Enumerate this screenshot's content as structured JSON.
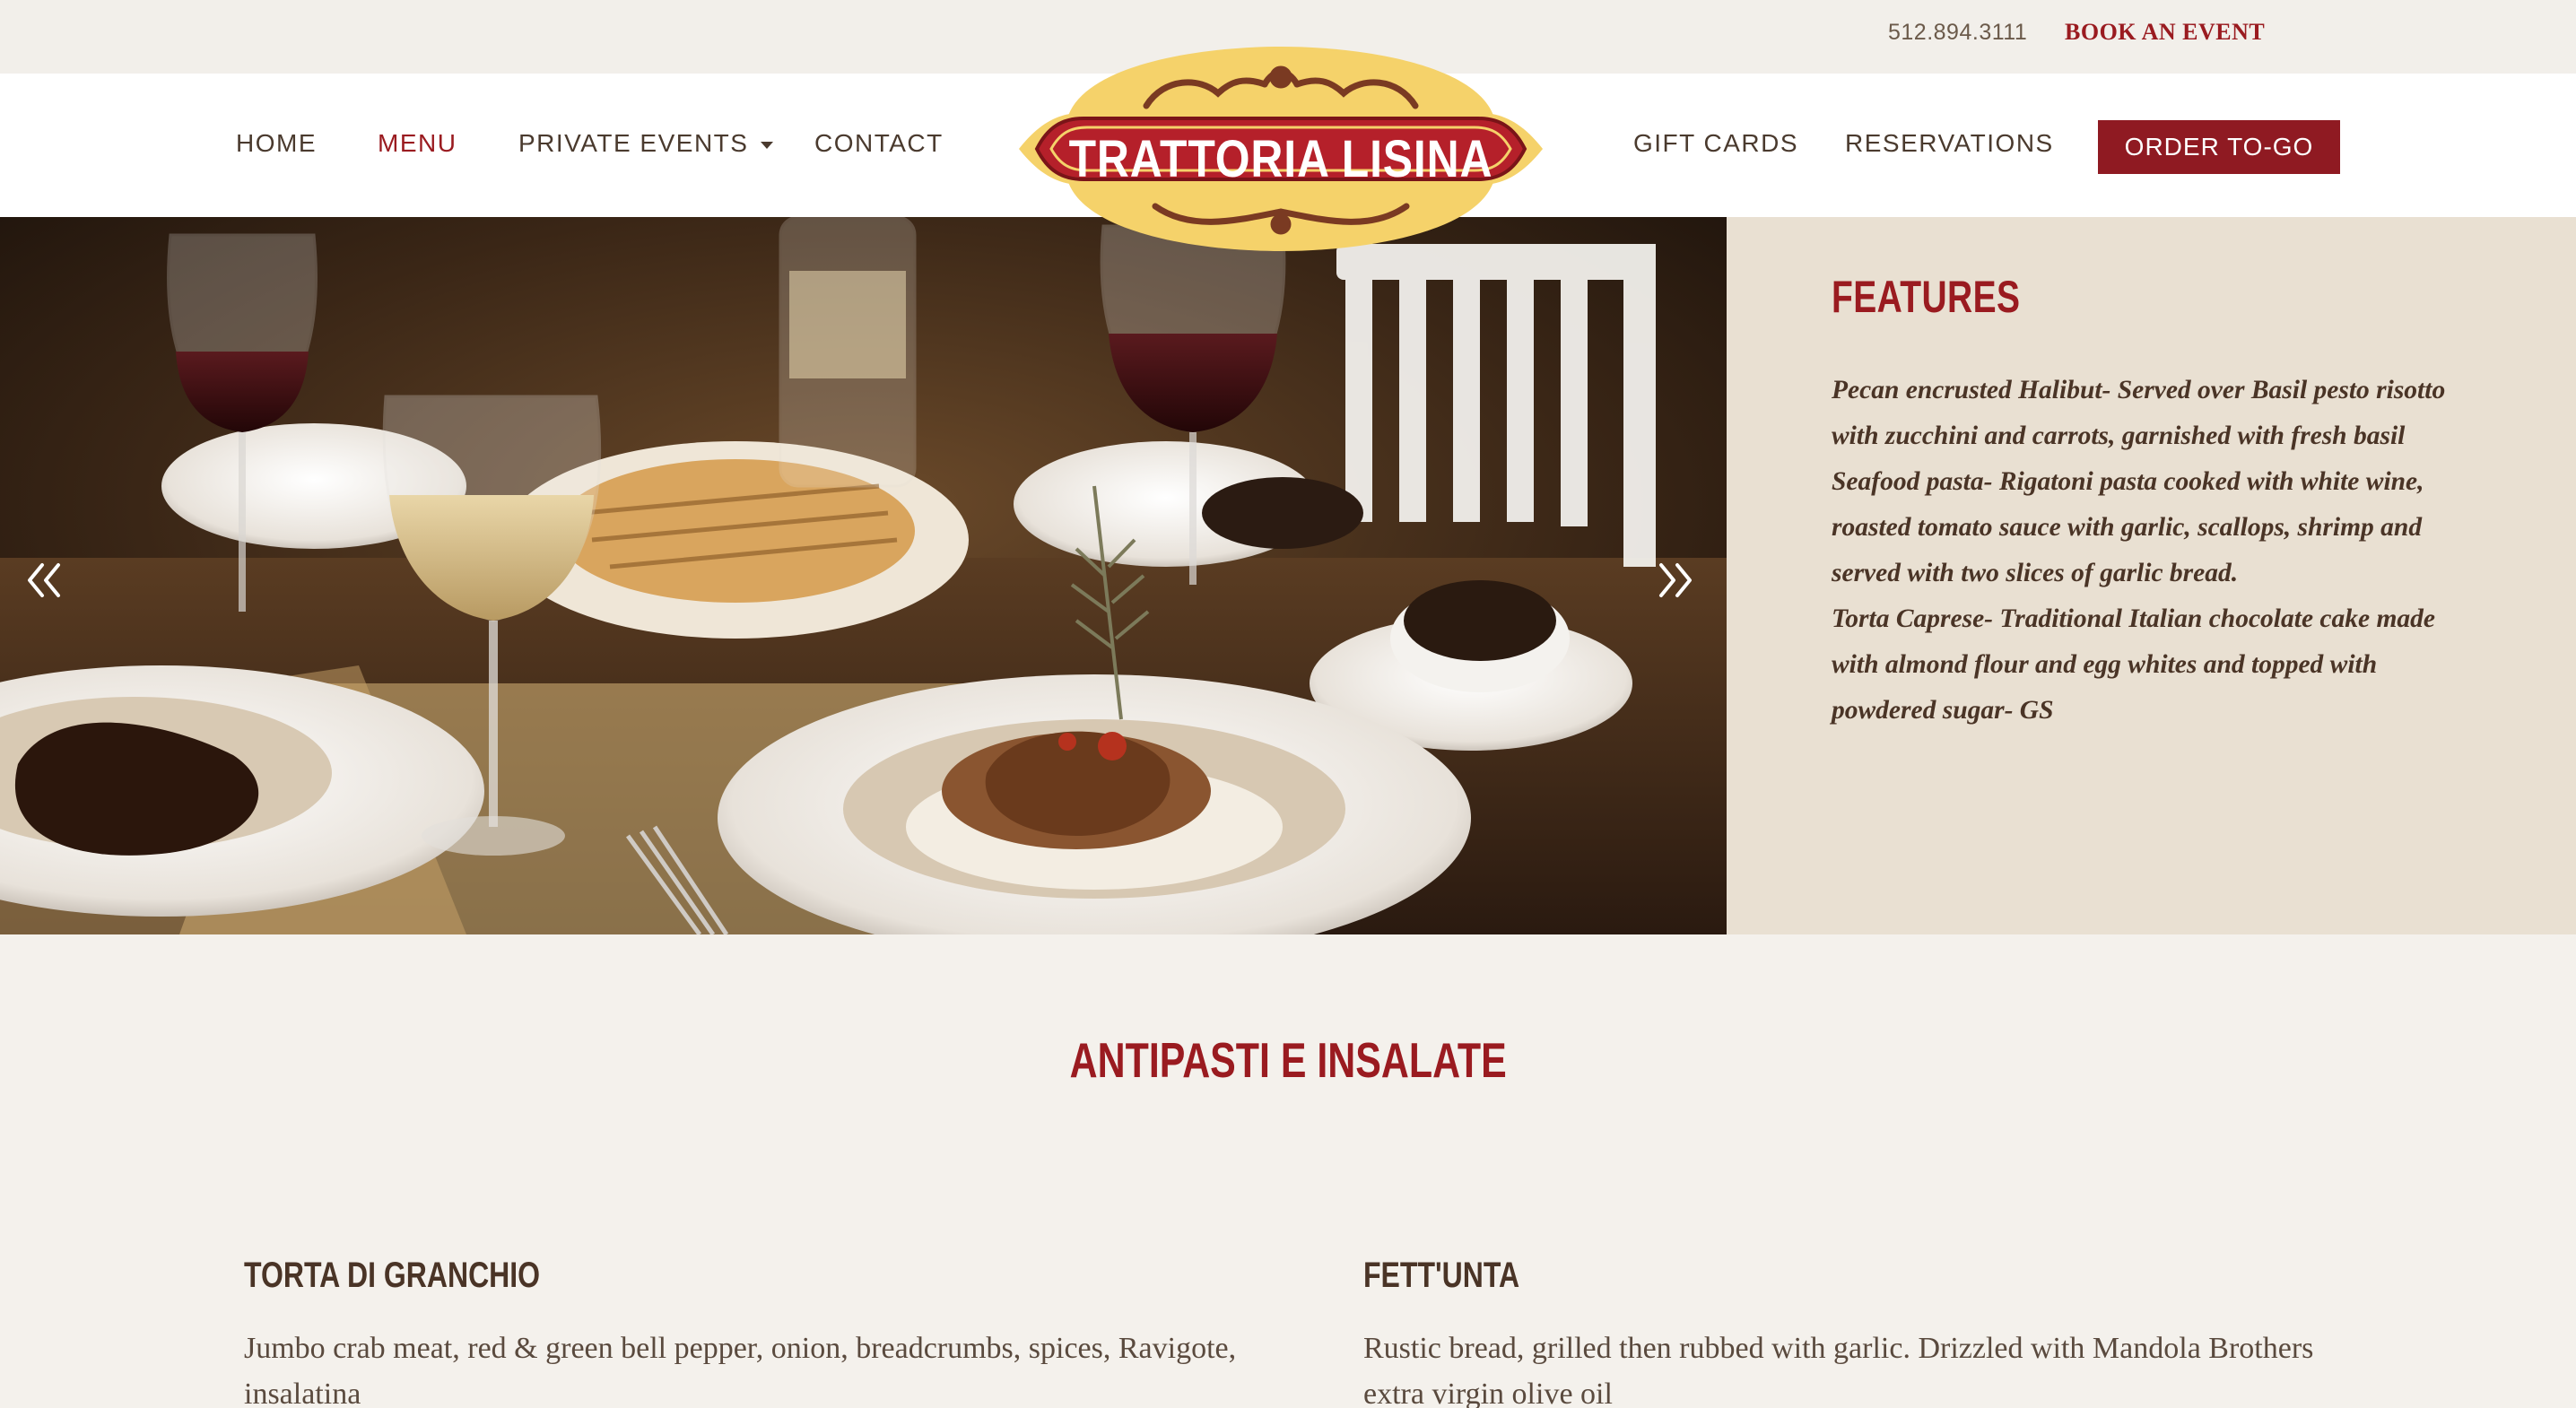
{
  "topbar": {
    "phone": "512.894.3111",
    "book_event": "BOOK AN EVENT"
  },
  "nav": {
    "left": [
      {
        "label": "HOME"
      },
      {
        "label": "MENU",
        "active": true
      },
      {
        "label": "PRIVATE EVENTS",
        "has_dropdown": true
      },
      {
        "label": "CONTACT"
      }
    ],
    "right": [
      {
        "label": "GIFT CARDS"
      },
      {
        "label": "RESERVATIONS"
      }
    ],
    "order_button": "ORDER TO-GO"
  },
  "logo": {
    "text": "TRATTORIA LISINA"
  },
  "hero": {
    "image_icon": "food-photo",
    "prev_icon": "double-chevron-left-icon",
    "next_icon": "double-chevron-right-icon"
  },
  "features": {
    "title": "FEATURES",
    "lines": [
      "Pecan encrusted Halibut- Served over Basil pesto risotto",
      "with zucchini and carrots, garnished with fresh basil",
      "Seafood pasta- Rigatoni pasta cooked with white wine,",
      "roasted tomato sauce with garlic, scallops, shrimp and",
      "served with two slices of garlic bread.",
      "Torta Caprese- Traditional Italian chocolate cake made",
      "with almond flour and egg whites and topped with",
      "powdered sugar- GS"
    ]
  },
  "menu": {
    "section_title": "ANTIPASTI E INSALATE",
    "items": [
      {
        "name": "TORTA DI GRANCHIO",
        "description": "Jumbo crab meat, red & green bell pepper, onion, breadcrumbs, spices, Ravigote, insalatina"
      },
      {
        "name": "FETT'UNTA",
        "description": "Rustic bread, grilled then rubbed with garlic. Drizzled with Mandola Brothers extra virgin olive oil"
      }
    ]
  },
  "colors": {
    "brand_red": "#9a1b20",
    "button_red": "#8f1a22",
    "text_brown": "#4a3426",
    "features_bg": "#e9e0d2",
    "page_bg": "#f4f1ec",
    "logo_yellow": "#f5d26a"
  }
}
